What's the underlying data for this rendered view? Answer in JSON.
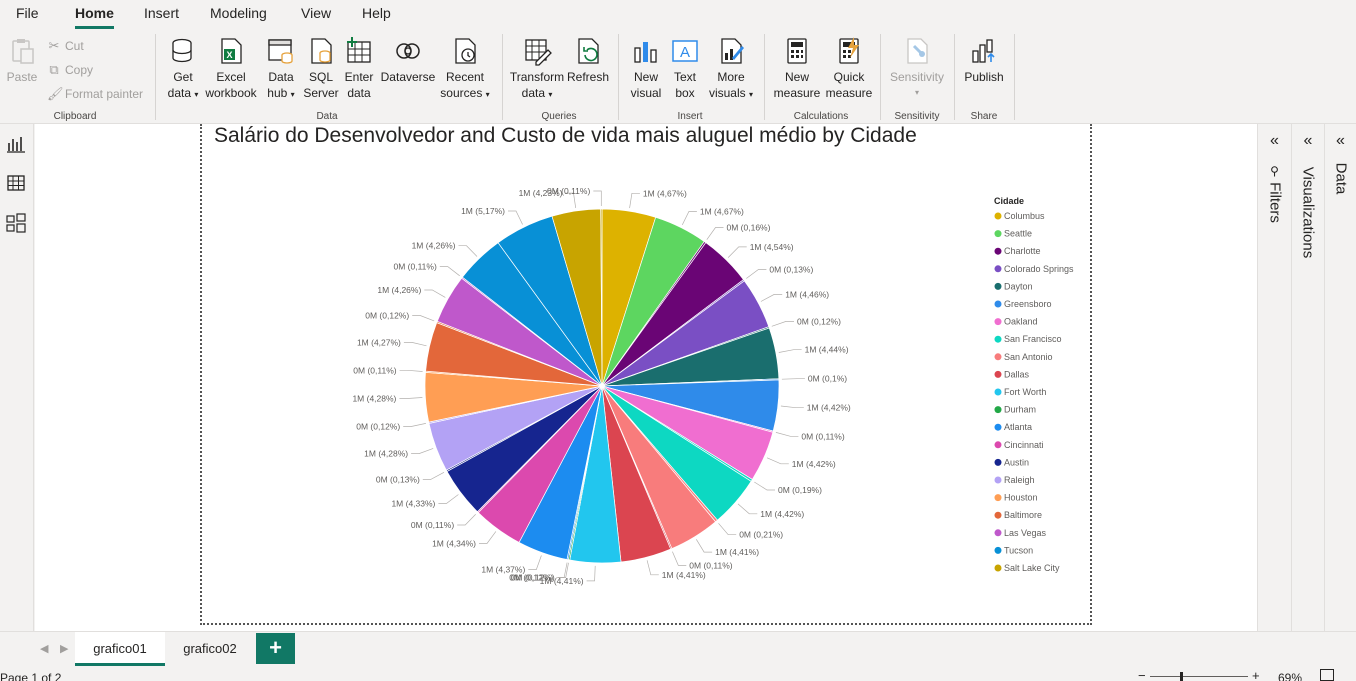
{
  "menu": {
    "items": [
      "File",
      "Home",
      "Insert",
      "Modeling",
      "View",
      "Help"
    ],
    "active": "Home"
  },
  "ribbon": {
    "clipboard": {
      "label": "Clipboard",
      "paste": "Paste",
      "cut": "Cut",
      "copy": "Copy",
      "format_painter": "Format painter"
    },
    "data": {
      "label": "Data",
      "get_data": [
        "Get",
        "data"
      ],
      "excel": [
        "Excel",
        "workbook"
      ],
      "data_hub": [
        "Data",
        "hub"
      ],
      "sql": [
        "SQL",
        "Server"
      ],
      "enter_data": [
        "Enter",
        "data"
      ],
      "dataverse": "Dataverse",
      "recent": [
        "Recent",
        "sources"
      ]
    },
    "queries": {
      "label": "Queries",
      "transform": [
        "Transform",
        "data"
      ],
      "refresh": "Refresh"
    },
    "insert": {
      "label": "Insert",
      "new_visual": [
        "New",
        "visual"
      ],
      "text_box": [
        "Text",
        "box"
      ],
      "more_visuals": [
        "More",
        "visuals"
      ]
    },
    "calculations": {
      "label": "Calculations",
      "new_measure": [
        "New",
        "measure"
      ],
      "quick_measure": [
        "Quick",
        "measure"
      ]
    },
    "sensitivity": {
      "label": "Sensitivity",
      "button": "Sensitivity"
    },
    "share": {
      "label": "Share",
      "publish": "Publish"
    }
  },
  "panes": {
    "filters": "Filters",
    "visualizations": "Visualizations",
    "data": "Data"
  },
  "tabs": {
    "pages": [
      "grafico01",
      "grafico02"
    ],
    "active": "grafico01",
    "add": "+"
  },
  "status": {
    "page": "Page 1 of 2",
    "zoom": "69%"
  },
  "colors": {
    "accent": "#117865"
  },
  "chart_data": {
    "type": "pie",
    "title": "Salário do Desenvolvedor and Custo de vida mais aluguel médio by Cidade",
    "legend_title": "Cidade",
    "legend_position": "right",
    "categories": [
      "Columbus",
      "Seattle",
      "Charlotte",
      "Colorado Springs",
      "Dayton",
      "Greensboro",
      "Oakland",
      "San Francisco",
      "San Antonio",
      "Dallas",
      "Fort Worth",
      "Durham",
      "Atlanta",
      "Cincinnati",
      "Austin",
      "Raleigh",
      "Houston",
      "Baltimore",
      "Las Vegas",
      "Tucson",
      "Salt Lake City"
    ],
    "category_colors": [
      "#DDB200",
      "#5DD660",
      "#6A0575",
      "#7A4FC4",
      "#1A6E6E",
      "#2F8BEA",
      "#F06ED0",
      "#0DD8C2",
      "#F87C7C",
      "#DB4550",
      "#22C6EE",
      "#22A847",
      "#1C8CF0",
      "#DC49AE",
      "#16258F",
      "#B3A2F5",
      "#FF9E54",
      "#E3673A",
      "#BF58CB",
      "#0890D6",
      "#C8A400"
    ],
    "slices": [
      {
        "category": "Columbus",
        "label": "1M (4,67%)",
        "value": 4.67
      },
      {
        "category": "Seattle",
        "label": "1M (4,67%)",
        "value": 4.67
      },
      {
        "category": "Charlotte",
        "label": "0M (0,16%)",
        "value": 0.16
      },
      {
        "category": "Charlotte",
        "label": "1M (4,54%)",
        "value": 4.54
      },
      {
        "category": "Colorado Springs",
        "label": "0M (0,13%)",
        "value": 0.13
      },
      {
        "category": "Colorado Springs",
        "label": "1M (4,46%)",
        "value": 4.46
      },
      {
        "category": "Dayton",
        "label": "0M (0,12%)",
        "value": 0.12
      },
      {
        "category": "Dayton",
        "label": "1M (4,44%)",
        "value": 4.44
      },
      {
        "category": "Greensboro",
        "label": "0M (0,1%)",
        "value": 0.1
      },
      {
        "category": "Greensboro",
        "label": "1M (4,42%)",
        "value": 4.42
      },
      {
        "category": "Oakland",
        "label": "0M (0,11%)",
        "value": 0.11
      },
      {
        "category": "Oakland",
        "label": "1M (4,42%)",
        "value": 4.42
      },
      {
        "category": "San Francisco",
        "label": "0M (0,19%)",
        "value": 0.19
      },
      {
        "category": "San Francisco",
        "label": "1M (4,42%)",
        "value": 4.42
      },
      {
        "category": "San Antonio",
        "label": "0M (0,21%)",
        "value": 0.21
      },
      {
        "category": "San Antonio",
        "label": "1M (4,41%)",
        "value": 4.41
      },
      {
        "category": "Dallas",
        "label": "0M (0,11%)",
        "value": 0.11
      },
      {
        "category": "Dallas",
        "label": "1M (4,41%)",
        "value": 4.41
      },
      {
        "category": "Fort Worth",
        "label": "1M (4,41%)",
        "value": 4.41
      },
      {
        "category": "Durham",
        "label": "0M (0,12%)",
        "value": 0.12
      },
      {
        "category": "Atlanta",
        "label": "0M (0,12%)",
        "value": 0.12
      },
      {
        "category": "Atlanta",
        "label": "1M (4,37%)",
        "value": 4.37
      },
      {
        "category": "Cincinnati",
        "label": "1M (4,34%)",
        "value": 4.34
      },
      {
        "category": "Cincinnati",
        "label": "0M (0,11%)",
        "value": 0.11
      },
      {
        "category": "Austin",
        "label": "1M (4,33%)",
        "value": 4.33
      },
      {
        "category": "Austin",
        "label": "0M (0,13%)",
        "value": 0.13
      },
      {
        "category": "Raleigh",
        "label": "1M (4,28%)",
        "value": 4.28
      },
      {
        "category": "Raleigh",
        "label": "0M (0,12%)",
        "value": 0.12
      },
      {
        "category": "Houston",
        "label": "1M (4,28%)",
        "value": 4.28
      },
      {
        "category": "Houston",
        "label": "0M (0,11%)",
        "value": 0.11
      },
      {
        "category": "Baltimore",
        "label": "1M (4,27%)",
        "value": 4.27
      },
      {
        "category": "Baltimore",
        "label": "0M (0,12%)",
        "value": 0.12
      },
      {
        "category": "Las Vegas",
        "label": "1M (4,26%)",
        "value": 4.26
      },
      {
        "category": "Las Vegas",
        "label": "0M (0,11%)",
        "value": 0.11
      },
      {
        "category": "Tucson",
        "label": "1M (4,26%)",
        "value": 4.26
      },
      {
        "category": "Tucson",
        "label": "1M (5,17%)",
        "value": 5.17
      },
      {
        "category": "Salt Lake City",
        "label": "1M (4,23%)",
        "value": 4.23
      },
      {
        "category": "Salt Lake City",
        "label": "0M (0,11%)",
        "value": 0.11
      }
    ]
  }
}
